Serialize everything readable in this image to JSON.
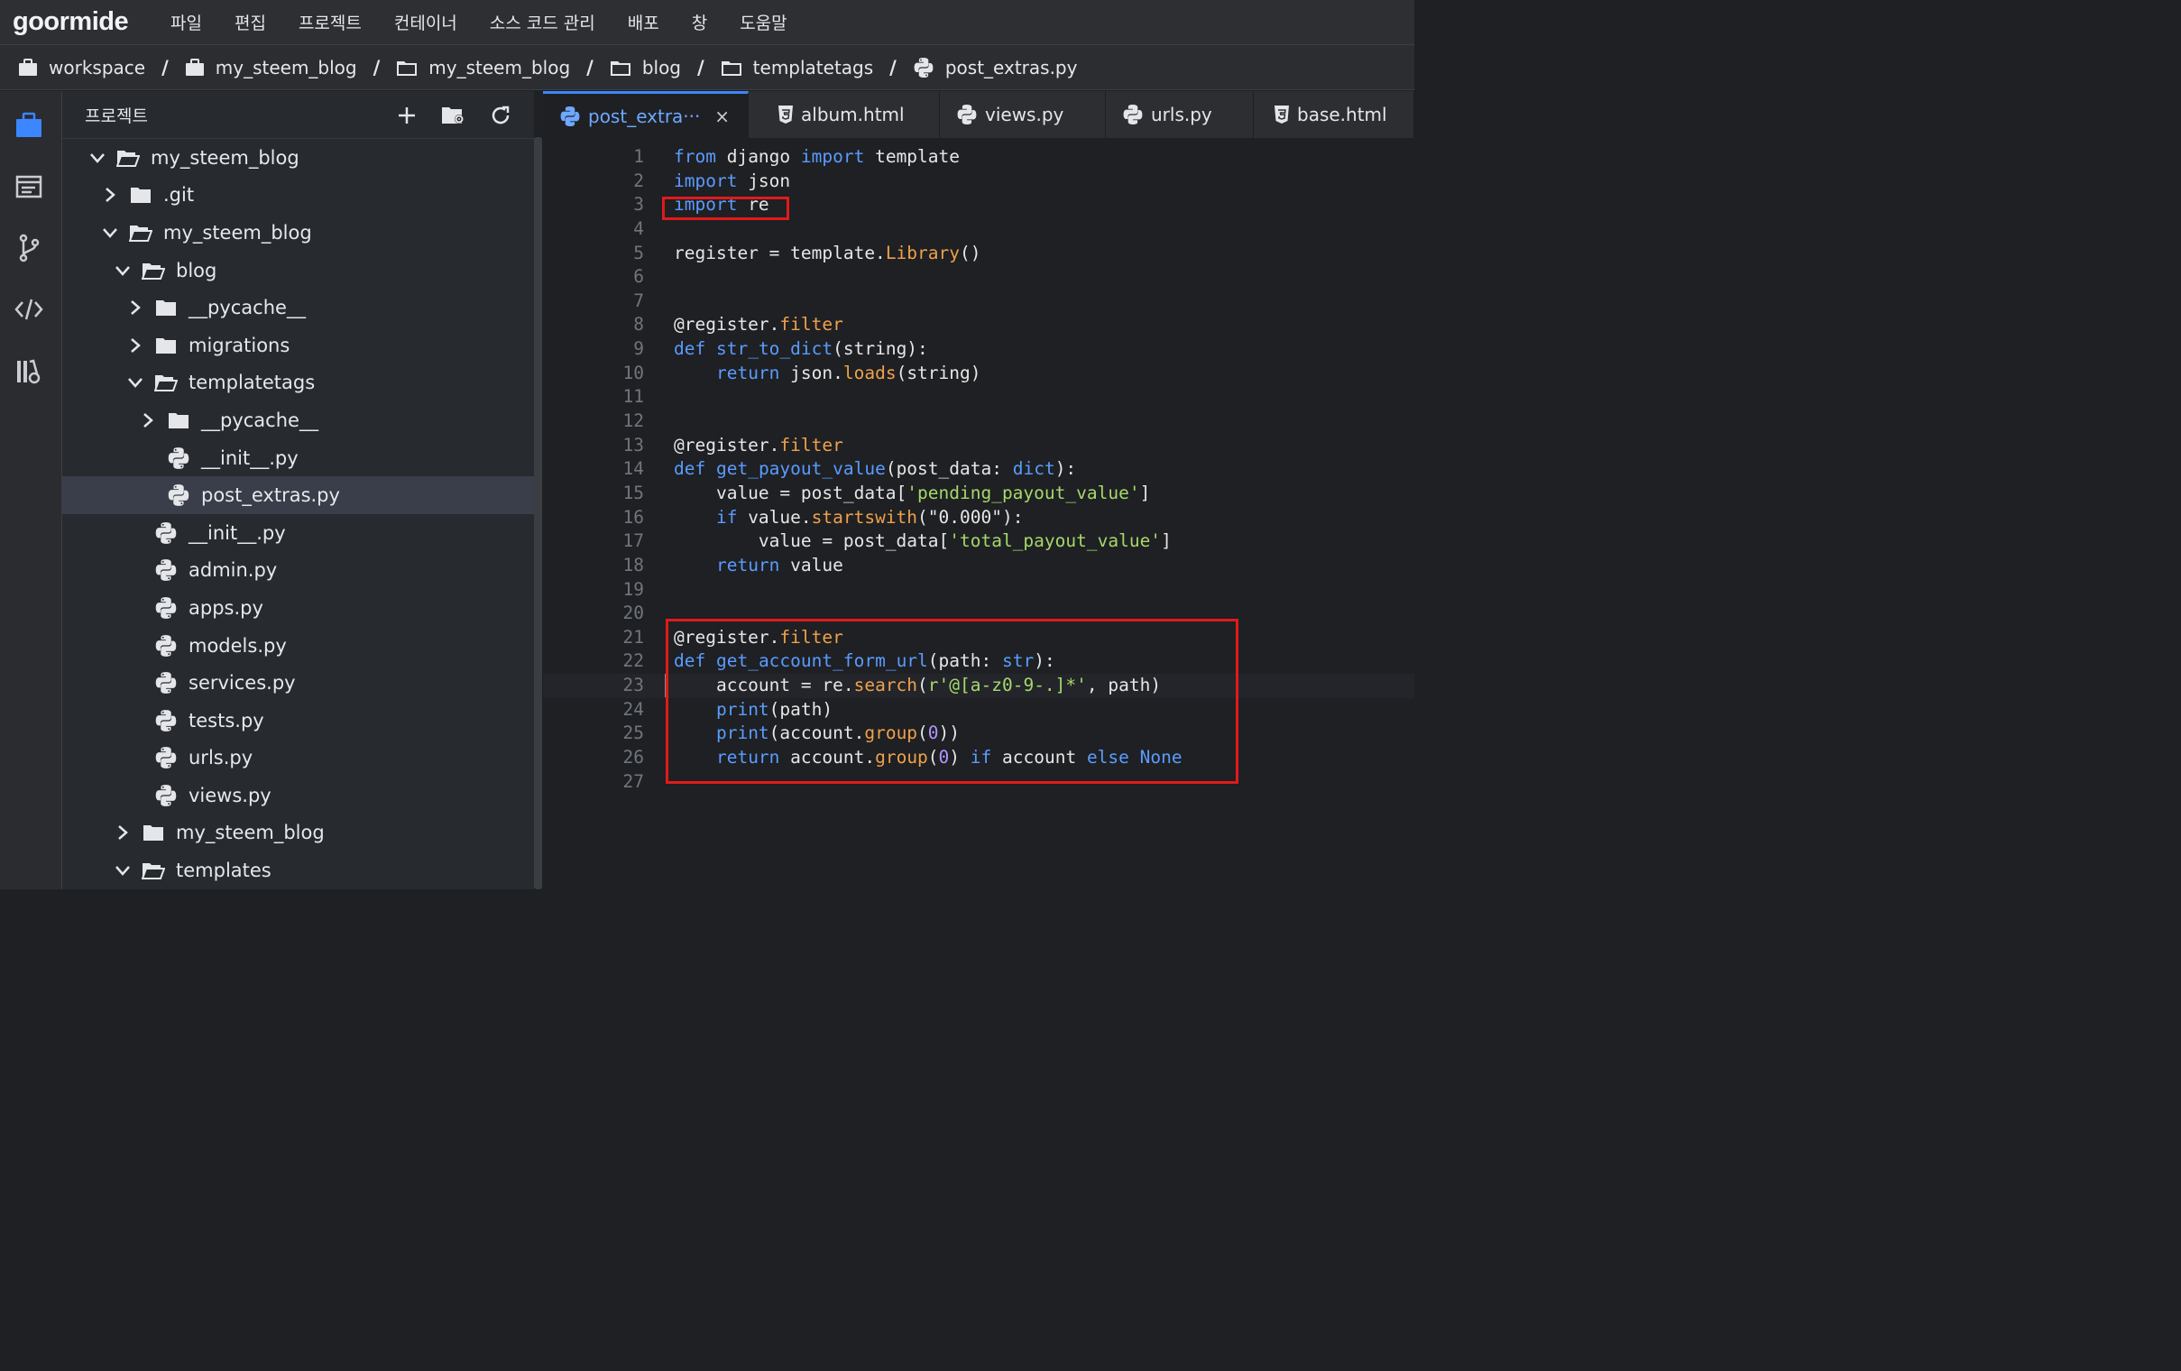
{
  "app": {
    "logo": "goormide",
    "menu": [
      "파일",
      "편집",
      "프로젝트",
      "컨테이너",
      "소스 코드 관리",
      "배포",
      "창",
      "도움말"
    ]
  },
  "breadcrumb": [
    "workspace",
    "my_steem_blog",
    "my_steem_blog",
    "blog",
    "templatetags",
    "post_extras.py"
  ],
  "panel": {
    "title": "프로젝트",
    "tree": [
      {
        "label": "my_steem_blog",
        "depth": 0,
        "type": "folder",
        "state": "open"
      },
      {
        "label": ".git",
        "depth": 1,
        "type": "folder",
        "state": "closed"
      },
      {
        "label": "my_steem_blog",
        "depth": 1,
        "type": "folder",
        "state": "open"
      },
      {
        "label": "blog",
        "depth": 2,
        "type": "folder",
        "state": "open"
      },
      {
        "label": "__pycache__",
        "depth": 3,
        "type": "folder",
        "state": "closed"
      },
      {
        "label": "migrations",
        "depth": 3,
        "type": "folder",
        "state": "closed"
      },
      {
        "label": "templatetags",
        "depth": 3,
        "type": "folder",
        "state": "open"
      },
      {
        "label": "__pycache__",
        "depth": 4,
        "type": "folder",
        "state": "closed"
      },
      {
        "label": "__init__.py",
        "depth": 4,
        "type": "py",
        "state": "file"
      },
      {
        "label": "post_extras.py",
        "depth": 4,
        "type": "py",
        "state": "file",
        "selected": true
      },
      {
        "label": "__init__.py",
        "depth": 3,
        "type": "py",
        "state": "file"
      },
      {
        "label": "admin.py",
        "depth": 3,
        "type": "py",
        "state": "file"
      },
      {
        "label": "apps.py",
        "depth": 3,
        "type": "py",
        "state": "file"
      },
      {
        "label": "models.py",
        "depth": 3,
        "type": "py",
        "state": "file"
      },
      {
        "label": "services.py",
        "depth": 3,
        "type": "py",
        "state": "file"
      },
      {
        "label": "tests.py",
        "depth": 3,
        "type": "py",
        "state": "file"
      },
      {
        "label": "urls.py",
        "depth": 3,
        "type": "py",
        "state": "file"
      },
      {
        "label": "views.py",
        "depth": 3,
        "type": "py",
        "state": "file"
      },
      {
        "label": "my_steem_blog",
        "depth": 2,
        "type": "folder",
        "state": "closed"
      },
      {
        "label": "templates",
        "depth": 2,
        "type": "folder",
        "state": "open"
      }
    ]
  },
  "tabs": [
    {
      "label": "post_extra···",
      "icon": "python-icon",
      "active": true,
      "closable": true
    },
    {
      "label": "album.html",
      "icon": "html-icon",
      "active": false
    },
    {
      "label": "views.py",
      "icon": "python-icon",
      "active": false
    },
    {
      "label": "urls.py",
      "icon": "python-icon",
      "active": false
    },
    {
      "label": "base.html",
      "icon": "html-icon",
      "active": false
    }
  ],
  "tab_close_glyph": "×",
  "code": {
    "lines": [
      [
        [
          "kw",
          "from"
        ],
        [
          "t",
          " django "
        ],
        [
          "kw",
          "import"
        ],
        [
          "t",
          " template"
        ]
      ],
      [
        [
          "kw",
          "import"
        ],
        [
          "t",
          " json"
        ]
      ],
      [
        [
          "kw",
          "import"
        ],
        [
          "t",
          " re"
        ]
      ],
      [],
      [
        [
          "t",
          "register = template."
        ],
        [
          "fn",
          "Library"
        ],
        [
          "t",
          "()"
        ]
      ],
      [],
      [],
      [
        [
          "t",
          "@register."
        ],
        [
          "fn",
          "filter"
        ]
      ],
      [
        [
          "kw",
          "def"
        ],
        [
          "t",
          " "
        ],
        [
          "kw",
          "str_to_dict"
        ],
        [
          "t",
          "(string):"
        ]
      ],
      [
        [
          "t",
          "    "
        ],
        [
          "kw",
          "return"
        ],
        [
          "t",
          " json."
        ],
        [
          "fn",
          "loads"
        ],
        [
          "t",
          "(string)"
        ]
      ],
      [],
      [],
      [
        [
          "t",
          "@register."
        ],
        [
          "fn",
          "filter"
        ]
      ],
      [
        [
          "kw",
          "def"
        ],
        [
          "t",
          " "
        ],
        [
          "kw",
          "get_payout_value"
        ],
        [
          "t",
          "(post_data: "
        ],
        [
          "kw",
          "dict"
        ],
        [
          "t",
          "):"
        ]
      ],
      [
        [
          "t",
          "    value = post_data["
        ],
        [
          "str",
          "'pending_payout_value'"
        ],
        [
          "t",
          "]"
        ]
      ],
      [
        [
          "t",
          "    "
        ],
        [
          "kw",
          "if"
        ],
        [
          "t",
          " value."
        ],
        [
          "fn",
          "startswith"
        ],
        [
          "t",
          "(\"0.000\"):"
        ]
      ],
      [
        [
          "t",
          "        value = post_data["
        ],
        [
          "str",
          "'total_payout_value'"
        ],
        [
          "t",
          "]"
        ]
      ],
      [
        [
          "t",
          "    "
        ],
        [
          "kw",
          "return"
        ],
        [
          "t",
          " value"
        ]
      ],
      [],
      [],
      [
        [
          "t",
          "@register."
        ],
        [
          "fn",
          "filter"
        ]
      ],
      [
        [
          "kw",
          "def"
        ],
        [
          "t",
          " "
        ],
        [
          "kw",
          "get_account_form_url"
        ],
        [
          "t",
          "(path: "
        ],
        [
          "kw",
          "str"
        ],
        [
          "t",
          "):"
        ]
      ],
      [
        [
          "t",
          "    account = re."
        ],
        [
          "fn",
          "search"
        ],
        [
          "t",
          "("
        ],
        [
          "str",
          "r'@[a-z0-9-.]*'"
        ],
        [
          "t",
          ", path)"
        ]
      ],
      [
        [
          "t",
          "    "
        ],
        [
          "kw",
          "print"
        ],
        [
          "t",
          "(path)"
        ]
      ],
      [
        [
          "t",
          "    "
        ],
        [
          "kw",
          "print"
        ],
        [
          "t",
          "(account."
        ],
        [
          "fn",
          "group"
        ],
        [
          "t",
          "("
        ],
        [
          "num",
          "0"
        ],
        [
          "t",
          "))"
        ]
      ],
      [
        [
          "t",
          "    "
        ],
        [
          "kw",
          "return"
        ],
        [
          "t",
          " account."
        ],
        [
          "fn",
          "group"
        ],
        [
          "t",
          "("
        ],
        [
          "num",
          "0"
        ],
        [
          "t",
          ") "
        ],
        [
          "kw",
          "if"
        ],
        [
          "t",
          " account "
        ],
        [
          "kw",
          "else"
        ],
        [
          "t",
          " "
        ],
        [
          "kw",
          "None"
        ]
      ],
      []
    ],
    "current_line": 23
  },
  "colors": {
    "keyword": "#5b9bff",
    "function": "#f0a14a",
    "string": "#a6d86a",
    "number": "#b694ff",
    "annotation_box": "#e11a1a",
    "active_tab": "#6ea8ff"
  }
}
